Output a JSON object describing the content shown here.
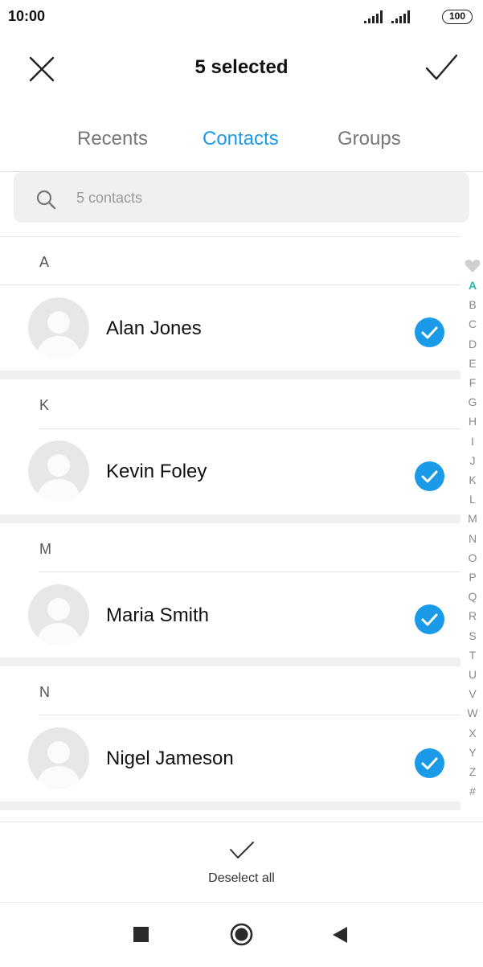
{
  "status_bar": {
    "time": "10:00",
    "battery": "100",
    "icons": [
      "signal-icon",
      "signal-icon",
      "battery-icon"
    ]
  },
  "header": {
    "title": "5 selected",
    "close_icon": "close-icon",
    "confirm_icon": "checkmark-icon"
  },
  "tabs": [
    {
      "label": "Recents",
      "active": false
    },
    {
      "label": "Contacts",
      "active": true
    },
    {
      "label": "Groups",
      "active": false
    }
  ],
  "search": {
    "placeholder": "5 contacts",
    "icon": "search-icon"
  },
  "sections": [
    {
      "letter": "A",
      "contacts": [
        {
          "name": "Alan Jones",
          "selected": true
        }
      ]
    },
    {
      "letter": "K",
      "contacts": [
        {
          "name": "Kevin Foley",
          "selected": true
        }
      ]
    },
    {
      "letter": "M",
      "contacts": [
        {
          "name": "Maria Smith",
          "selected": true
        }
      ]
    },
    {
      "letter": "N",
      "contacts": [
        {
          "name": "Nigel Jameson",
          "selected": true
        }
      ]
    }
  ],
  "index_bar": {
    "favorite_icon": "heart-icon",
    "active": "A",
    "letters": [
      "A",
      "B",
      "C",
      "D",
      "E",
      "F",
      "G",
      "H",
      "I",
      "J",
      "K",
      "L",
      "M",
      "N",
      "O",
      "P",
      "Q",
      "R",
      "S",
      "T",
      "U",
      "V",
      "W",
      "X",
      "Y",
      "Z",
      "#"
    ]
  },
  "footer": {
    "deselect_label": "Deselect all",
    "deselect_icon": "checkmark-icon"
  },
  "nav_bar": {
    "icons": [
      "recent-apps-icon",
      "home-icon",
      "back-icon"
    ]
  },
  "colors": {
    "accent": "#1b9ae8",
    "index_active": "#2ab5b0",
    "divider": "#e3e3e3",
    "gap": "#f0f0f0"
  }
}
